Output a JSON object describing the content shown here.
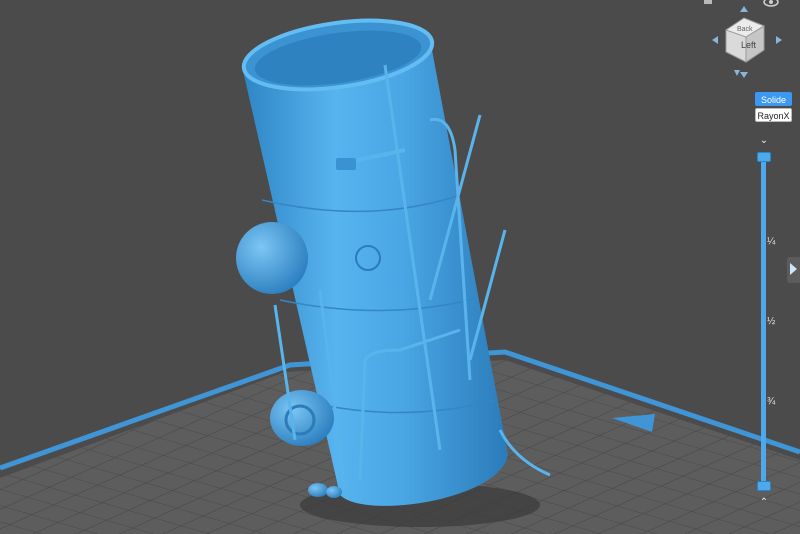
{
  "view_modes": {
    "solid": "Solide",
    "xray": "RayonX"
  },
  "navcube": {
    "face_label": "Left",
    "top_label": "Back"
  },
  "layer_slider": {
    "tick_quarter": "¼",
    "tick_half": "½",
    "tick_three_quarter": "¾",
    "top_value": 0,
    "bottom_value": 1
  },
  "colors": {
    "model": "#4aa8e6",
    "accent": "#3c98f0",
    "background": "#4b4b4b",
    "plate": "#5e5e5e",
    "plate_border": "#3f95d6"
  }
}
